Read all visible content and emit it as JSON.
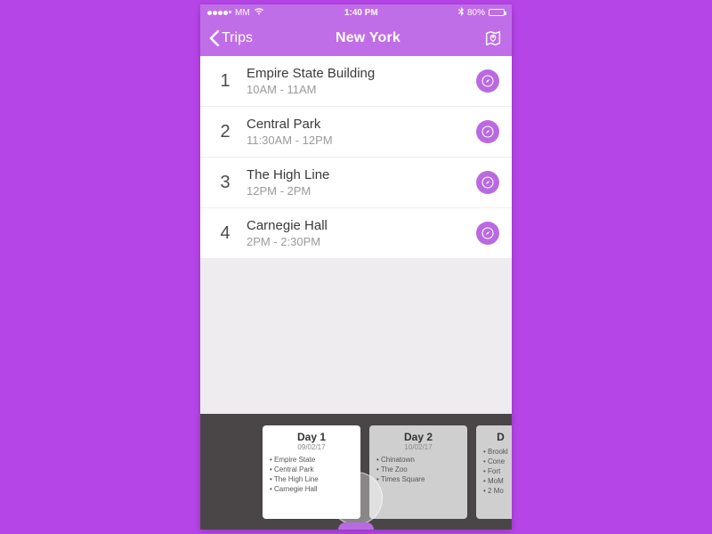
{
  "status": {
    "carrier": "MM",
    "time": "1:40 PM",
    "battery_pct": "80%"
  },
  "nav": {
    "back_label": "Trips",
    "title": "New York"
  },
  "stops": [
    {
      "num": "1",
      "title": "Empire State Building",
      "time": "10AM - 11AM"
    },
    {
      "num": "2",
      "title": "Central Park",
      "time": "11:30AM - 12PM"
    },
    {
      "num": "3",
      "title": "The High Line",
      "time": "12PM - 2PM"
    },
    {
      "num": "4",
      "title": "Carnegie Hall",
      "time": "2PM - 2:30PM"
    }
  ],
  "days": [
    {
      "label": "Day 1",
      "date": "09/02/17",
      "items": [
        "Empire State",
        "Central Park",
        "The High Line",
        "Carnegie Hall"
      ],
      "active": true
    },
    {
      "label": "Day 2",
      "date": "10/02/17",
      "items": [
        "Chinatown",
        "The Zoo",
        "Times Square"
      ],
      "active": false
    },
    {
      "label": "D",
      "date": "",
      "items": [
        "Brookl",
        "Cone",
        "Fort",
        "MoM",
        "2 Mo"
      ],
      "active": false,
      "partial": true
    }
  ]
}
